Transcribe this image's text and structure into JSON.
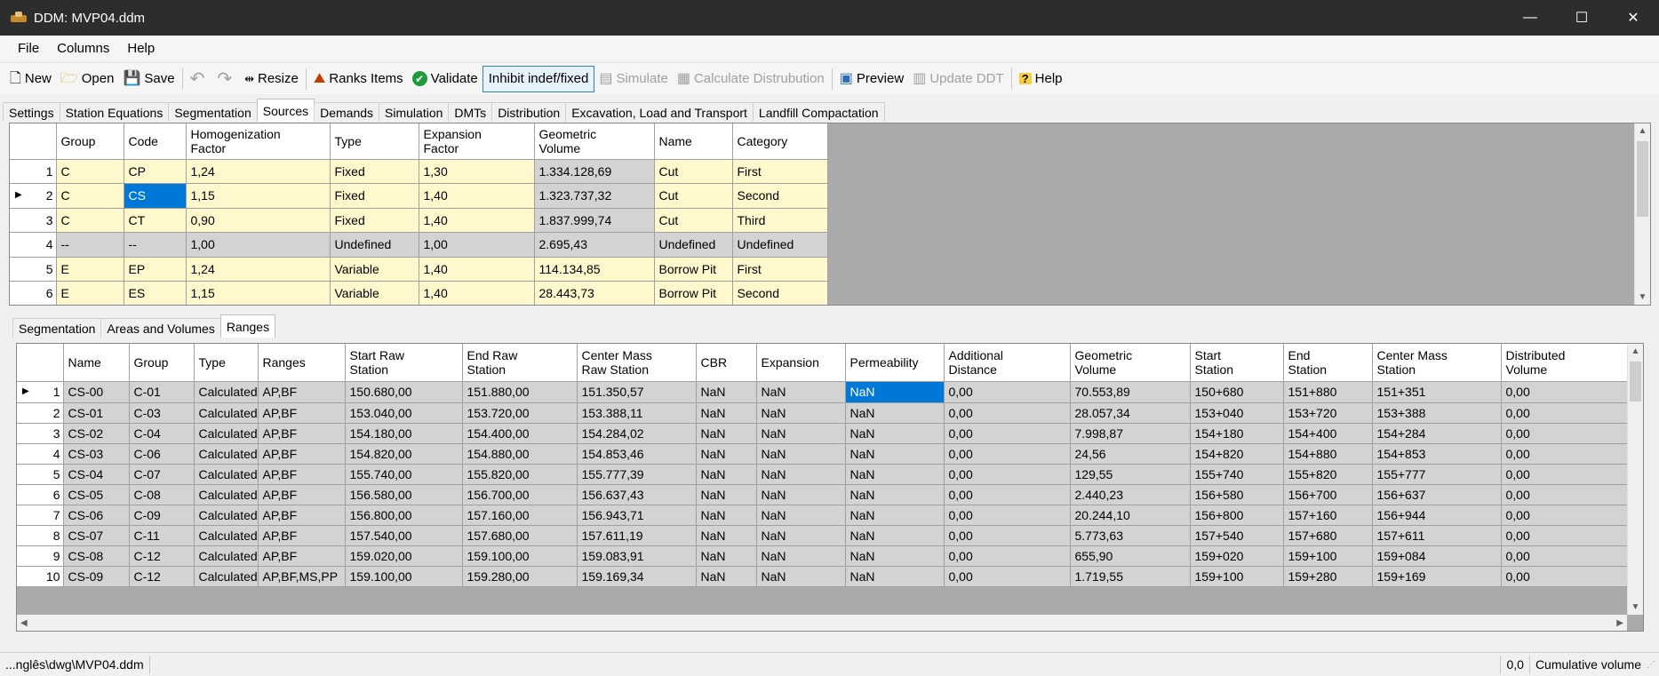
{
  "window": {
    "title": "DDM: MVP04.ddm",
    "minimize": "—",
    "maximize": "☐",
    "close": "✕"
  },
  "menu": [
    "File",
    "Columns",
    "Help"
  ],
  "toolbar": {
    "new": "New",
    "open": "Open",
    "save": "Save",
    "resize": "Resize",
    "ranks": "Ranks Items",
    "validate": "Validate",
    "inhibit": "Inhibit indef/fixed",
    "simulate": "Simulate",
    "calc": "Calculate Distrubution",
    "preview": "Preview",
    "update": "Update DDT",
    "help": "Help"
  },
  "main_tabs": [
    "Settings",
    "Station Equations",
    "Segmentation",
    "Sources",
    "Demands",
    "Simulation",
    "DMTs",
    "Distribution",
    "Excavation, Load and Transport",
    "Landfill Compactation"
  ],
  "sources": {
    "headers": [
      "Group",
      "Code",
      "Homogenization Factor",
      "Type",
      "Expansion Factor",
      "Geometric Volume",
      "Name",
      "Category"
    ],
    "rows": [
      [
        "1",
        "C",
        "CP",
        "1,24",
        "Fixed",
        "1,30",
        "1.334.128,69",
        "Cut",
        "First"
      ],
      [
        "2",
        "C",
        "CS",
        "1,15",
        "Fixed",
        "1,40",
        "1.323.737,32",
        "Cut",
        "Second"
      ],
      [
        "3",
        "C",
        "CT",
        "0,90",
        "Fixed",
        "1,40",
        "1.837.999,74",
        "Cut",
        "Third"
      ],
      [
        "4",
        "--",
        "--",
        "1,00",
        "Undefined",
        "1,00",
        "2.695,43",
        "Undefined",
        "Undefined"
      ],
      [
        "5",
        "E",
        "EP",
        "1,24",
        "Variable",
        "1,40",
        "114.134,85",
        "Borrow Pit",
        "First"
      ],
      [
        "6",
        "E",
        "ES",
        "1,15",
        "Variable",
        "1,40",
        "28.443,73",
        "Borrow Pit",
        "Second"
      ]
    ]
  },
  "sub_tabs": [
    "Segmentation",
    "Areas and Volumes",
    "Ranges"
  ],
  "ranges": {
    "headers": [
      "Name",
      "Group",
      "Type",
      "Ranges",
      "Start Raw Station",
      "End Raw Station",
      "Center Mass Raw Station",
      "CBR",
      "Expansion",
      "Permeability",
      "Additional Distance",
      "Geometric Volume",
      "Start Station",
      "End Station",
      "Center Mass Station",
      "Distributed Volume"
    ],
    "rows": [
      [
        "1",
        "CS-00",
        "C-01",
        "Calculated",
        "AP,BF",
        "150.680,00",
        "151.880,00",
        "151.350,57",
        "NaN",
        "NaN",
        "NaN",
        "0,00",
        "70.553,89",
        "150+680",
        "151+880",
        "151+351",
        "0,00"
      ],
      [
        "2",
        "CS-01",
        "C-03",
        "Calculated",
        "AP,BF",
        "153.040,00",
        "153.720,00",
        "153.388,11",
        "NaN",
        "NaN",
        "NaN",
        "0,00",
        "28.057,34",
        "153+040",
        "153+720",
        "153+388",
        "0,00"
      ],
      [
        "3",
        "CS-02",
        "C-04",
        "Calculated",
        "AP,BF",
        "154.180,00",
        "154.400,00",
        "154.284,02",
        "NaN",
        "NaN",
        "NaN",
        "0,00",
        "7.998,87",
        "154+180",
        "154+400",
        "154+284",
        "0,00"
      ],
      [
        "4",
        "CS-03",
        "C-06",
        "Calculated",
        "AP,BF",
        "154.820,00",
        "154.880,00",
        "154.853,46",
        "NaN",
        "NaN",
        "NaN",
        "0,00",
        "24,56",
        "154+820",
        "154+880",
        "154+853",
        "0,00"
      ],
      [
        "5",
        "CS-04",
        "C-07",
        "Calculated",
        "AP,BF",
        "155.740,00",
        "155.820,00",
        "155.777,39",
        "NaN",
        "NaN",
        "NaN",
        "0,00",
        "129,55",
        "155+740",
        "155+820",
        "155+777",
        "0,00"
      ],
      [
        "6",
        "CS-05",
        "C-08",
        "Calculated",
        "AP,BF",
        "156.580,00",
        "156.700,00",
        "156.637,43",
        "NaN",
        "NaN",
        "NaN",
        "0,00",
        "2.440,23",
        "156+580",
        "156+700",
        "156+637",
        "0,00"
      ],
      [
        "7",
        "CS-06",
        "C-09",
        "Calculated",
        "AP,BF",
        "156.800,00",
        "157.160,00",
        "156.943,71",
        "NaN",
        "NaN",
        "NaN",
        "0,00",
        "20.244,10",
        "156+800",
        "157+160",
        "156+944",
        "0,00"
      ],
      [
        "8",
        "CS-07",
        "C-11",
        "Calculated",
        "AP,BF",
        "157.540,00",
        "157.680,00",
        "157.611,19",
        "NaN",
        "NaN",
        "NaN",
        "0,00",
        "5.773,63",
        "157+540",
        "157+680",
        "157+611",
        "0,00"
      ],
      [
        "9",
        "CS-08",
        "C-12",
        "Calculated",
        "AP,BF",
        "159.020,00",
        "159.100,00",
        "159.083,91",
        "NaN",
        "NaN",
        "NaN",
        "0,00",
        "655,90",
        "159+020",
        "159+100",
        "159+084",
        "0,00"
      ],
      [
        "10",
        "CS-09",
        "C-12",
        "Calculated",
        "AP,BF,MS,PP",
        "159.100,00",
        "159.280,00",
        "159.169,34",
        "NaN",
        "NaN",
        "NaN",
        "0,00",
        "1.719,55",
        "159+100",
        "159+280",
        "159+169",
        "0,00"
      ]
    ]
  },
  "status": {
    "path": "...nglês\\dwg\\MVP04.ddm",
    "coord": "0,0",
    "mode": "Cumulative volume"
  }
}
